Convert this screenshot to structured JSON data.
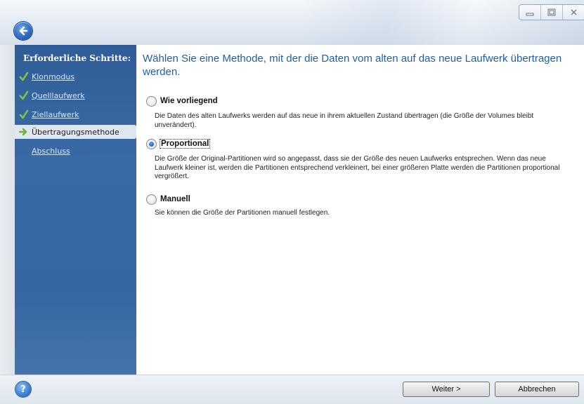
{
  "window": {
    "controls": [
      "minimize",
      "maximize",
      "close"
    ]
  },
  "sidebar": {
    "title": "Erforderliche Schritte:",
    "steps": [
      {
        "label": "Klonmodus",
        "state": "done",
        "icon": "check-icon"
      },
      {
        "label": "Quelllaufwerk",
        "state": "done",
        "icon": "check-icon"
      },
      {
        "label": "Ziellaufwerk",
        "state": "done",
        "icon": "check-icon"
      },
      {
        "label": "Übertragungsmethode",
        "state": "current",
        "icon": "arrow-right-icon"
      },
      {
        "label": "Abschluss",
        "state": "pending",
        "icon": ""
      }
    ]
  },
  "main": {
    "title": "Wählen Sie eine Methode, mit der die Daten vom alten auf das neue Laufwerk übertragen werden.",
    "options": [
      {
        "label": "Wie vorliegend",
        "checked": false,
        "description": "Die Daten des alten Laufwerks werden auf das neue in ihrem aktuellen Zustand übertragen (die Größe der Volumes bleibt unverändert)."
      },
      {
        "label": "Proportional",
        "checked": true,
        "description": "Die Größe der Original-Partitionen wird so angepasst, dass sie der Größe des neuen Laufwerks entsprechen. Wenn das neue Laufwerk kleiner ist, werden die Partitionen entsprechend verkleinert, bei einer größeren Platte werden die Partitionen proportional vergrößert."
      },
      {
        "label": "Manuell",
        "checked": false,
        "description": "Sie können die Größe der Partitionen manuell festlegen."
      }
    ]
  },
  "footer": {
    "help_label": "?",
    "next_label": "Weiter >",
    "cancel_label": "Abbrechen"
  },
  "colors": {
    "accent": "#1f5fa8",
    "sidebar": "#3465a0",
    "check": "#7dc242"
  }
}
